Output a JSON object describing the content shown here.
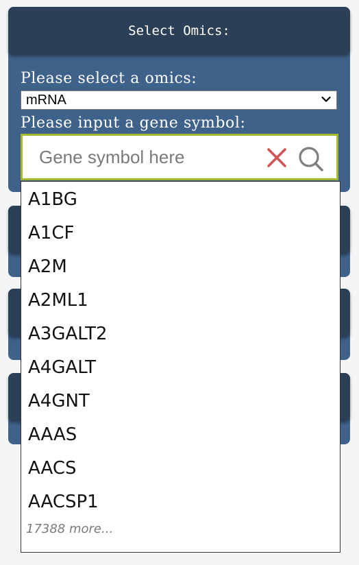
{
  "main_panel": {
    "title": "Select Omics:",
    "omics_label": "Please select a omics:",
    "omics_selected": "mRNA",
    "gene_label": "Please input a gene symbol:",
    "gene_placeholder": "Gene symbol here"
  },
  "dropdown": {
    "items": [
      "A1BG",
      "A1CF",
      "A2M",
      "A2ML1",
      "A3GALT2",
      "A4GALT",
      "A4GNT",
      "AAAS",
      "AACS",
      "AACSP1"
    ],
    "more_text": "17388 more..."
  },
  "colors": {
    "header": "#2b3f57",
    "panel": "#3f628a",
    "search_border": "#a6b82b",
    "clear_icon": "#d25252",
    "search_icon": "#7f7f7f"
  },
  "icons": {
    "clear": "close-icon",
    "search": "search-icon",
    "select_arrow": "chevron-down-icon"
  }
}
